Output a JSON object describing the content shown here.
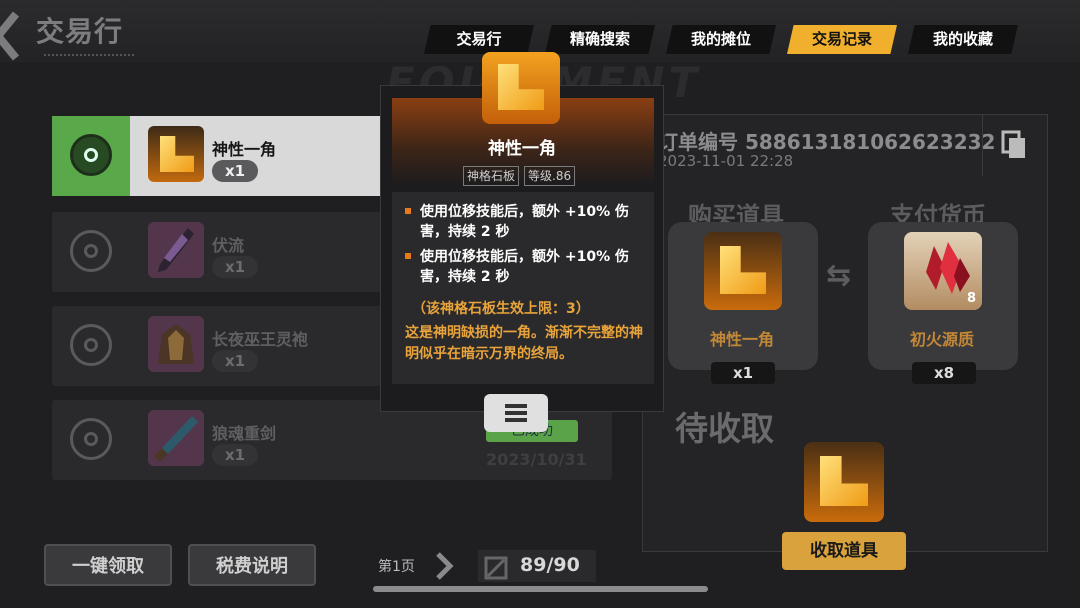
{
  "header": {
    "title": "交易行",
    "watermark": "EQUIPMENT",
    "tabs": [
      {
        "label": "交易行",
        "active": false
      },
      {
        "label": "精确搜索",
        "active": false
      },
      {
        "label": "我的摊位",
        "active": false
      },
      {
        "label": "交易记录",
        "active": true
      },
      {
        "label": "我的收藏",
        "active": false
      }
    ]
  },
  "list": {
    "items": [
      {
        "name": "神性一角",
        "qty": "x1",
        "selected": true,
        "icon": "golden-corner-shard-icon"
      },
      {
        "name": "伏流",
        "qty": "x1",
        "selected": false,
        "icon": "dark-dagger-icon"
      },
      {
        "name": "长夜巫王灵袍",
        "qty": "x1",
        "selected": false,
        "icon": "robe-icon"
      },
      {
        "name": "狼魂重剑",
        "qty": "x1",
        "selected": false,
        "icon": "greatsword-icon"
      }
    ],
    "row4_status": "已成功",
    "row4_date": "2023/10/31"
  },
  "tooltip": {
    "item_name": "神性一角",
    "tags": [
      "神格石板",
      "等级.86"
    ],
    "effects": [
      "使用位移技能后，额外 +10% 伤害，持续 2 秒",
      "使用位移技能后，额外 +10% 伤害，持续 2 秒"
    ],
    "limit": "（该神格石板生效上限：3）",
    "lore": "这是神明缺损的一角。渐渐不完整的神明似乎在暗示万界的终局。"
  },
  "order": {
    "label": "订单编号 588613181062623232",
    "time": "2023-11-01 22:28"
  },
  "trade": {
    "buy_title": "购买道具",
    "pay_title": "支付货币",
    "buy_item": {
      "name": "神性一角",
      "qty": "x1"
    },
    "pay_item": {
      "name": "初火源质",
      "qty": "x8",
      "badge": "8"
    },
    "pending_title": "待收取",
    "collect_label": "收取道具"
  },
  "bottom": {
    "claim_all": "一键领取",
    "tax_info": "税费说明",
    "page_label": "第1页",
    "capacity": "89/90"
  },
  "colors": {
    "accent": "#f0b02e",
    "selected_green": "#59a84a",
    "item_name_orange": "#c28737",
    "lore_orange": "#e8a33a"
  }
}
